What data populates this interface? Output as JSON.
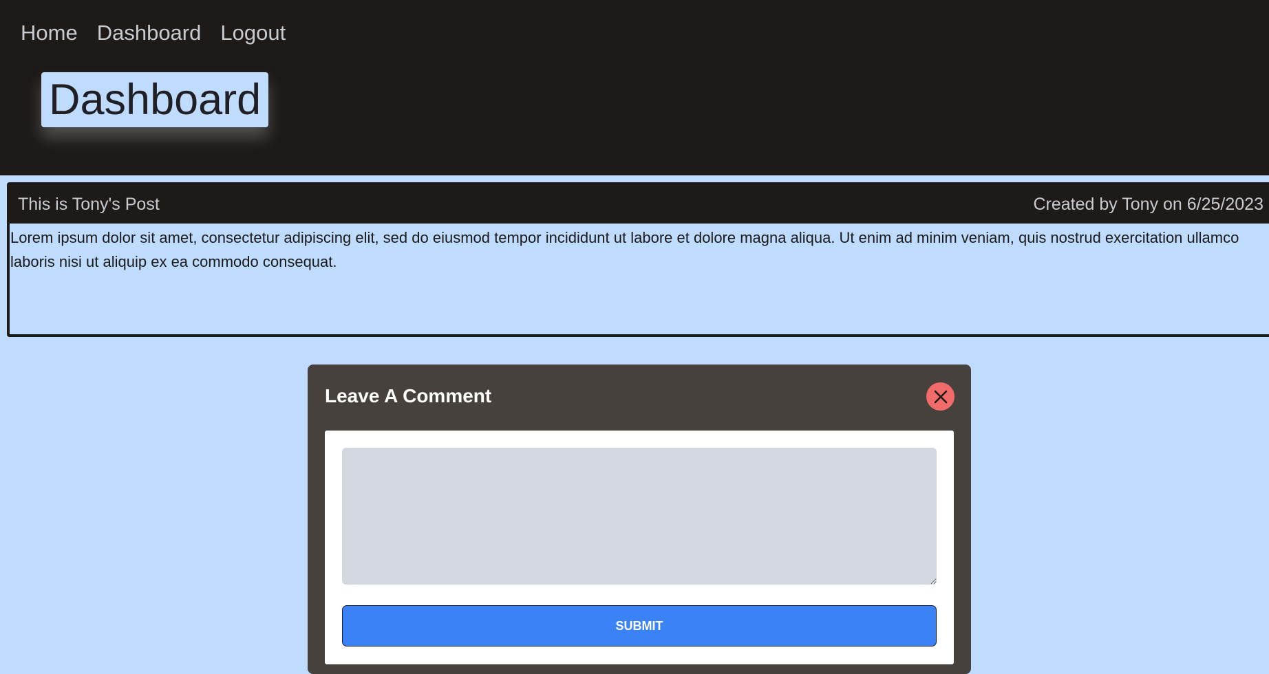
{
  "nav": {
    "items": [
      {
        "label": "Home"
      },
      {
        "label": "Dashboard"
      },
      {
        "label": "Logout"
      }
    ]
  },
  "header": {
    "title": "Dashboard"
  },
  "post": {
    "title": "This is Tony's Post",
    "meta": "Created by Tony on 6/25/2023",
    "body": "Lorem ipsum dolor sit amet, consectetur adipiscing elit, sed do eiusmod tempor incididunt ut labore et dolore magna aliqua. Ut enim ad minim veniam, quis nostrud exercitation ullamco laboris nisi ut aliquip ex ea commodo consequat."
  },
  "comment_form": {
    "title": "Leave A Comment",
    "close_icon": "close-icon",
    "input_value": "",
    "input_placeholder": "",
    "submit_label": "SUBMIT"
  },
  "colors": {
    "page_background": "#bfdbfe",
    "header_background": "#1e1a18",
    "card_background": "#46413d",
    "close_button": "#f26b6b",
    "submit_button": "#3b82f6",
    "input_background": "#d3d7df"
  }
}
